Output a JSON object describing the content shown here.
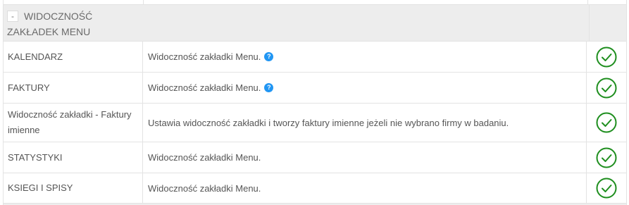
{
  "section": {
    "collapse_symbol": "-",
    "title": "WIDOCZNOŚĆ ZAKŁADEK MENU"
  },
  "rows": [
    {
      "name": "KALENDARZ",
      "description": "Widoczność zakładki Menu.",
      "has_help": true,
      "help_symbol": "?",
      "status": "enabled"
    },
    {
      "name": "FAKTURY",
      "description": "Widoczność zakładki Menu.",
      "has_help": true,
      "help_symbol": "?",
      "status": "enabled"
    },
    {
      "name": "Widoczność zakładki - Faktury imienne",
      "description": "Ustawia widoczność zakładki i tworzy faktury imienne jeżeli nie wybrano firmy w badaniu.",
      "has_help": false,
      "status": "enabled"
    },
    {
      "name": "STATYSTYKI",
      "description": "Widoczność zakładki Menu.",
      "has_help": false,
      "status": "enabled"
    },
    {
      "name": "KSIEGI I SPISY",
      "description": "Widoczność zakładki Menu.",
      "has_help": false,
      "status": "enabled"
    }
  ],
  "colors": {
    "check": "#1e8e1e",
    "help": "#2196f3",
    "header_bg": "#ededed"
  },
  "icons": {
    "check": "check-circle-icon",
    "help": "question-circle-icon",
    "collapse": "minus-icon"
  }
}
